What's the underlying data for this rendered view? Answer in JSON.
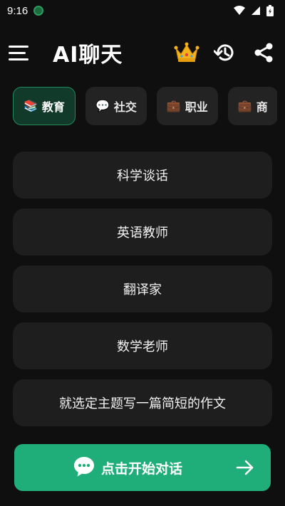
{
  "status_bar": {
    "time": "9:16"
  },
  "header": {
    "title": "AI聊天"
  },
  "tabs": [
    {
      "icon": "📚",
      "label": "教育",
      "active": true
    },
    {
      "icon": "💬",
      "label": "社交",
      "active": false
    },
    {
      "icon": "💼",
      "label": "职业",
      "active": false
    },
    {
      "icon": "💼",
      "label": "商",
      "active": false
    }
  ],
  "options": [
    {
      "label": "科学谈话"
    },
    {
      "label": "英语教师"
    },
    {
      "label": "翻译家"
    },
    {
      "label": "数学老师"
    },
    {
      "label": "就选定主题写一篇简短的作文"
    }
  ],
  "start_button": {
    "label": "点击开始对话"
  },
  "colors": {
    "accent": "#1fae7a",
    "background": "#0f0f0f",
    "card": "#1e1e1e",
    "tab_active_bg": "#123a2a",
    "tab_active_border": "#1f8a5b"
  }
}
